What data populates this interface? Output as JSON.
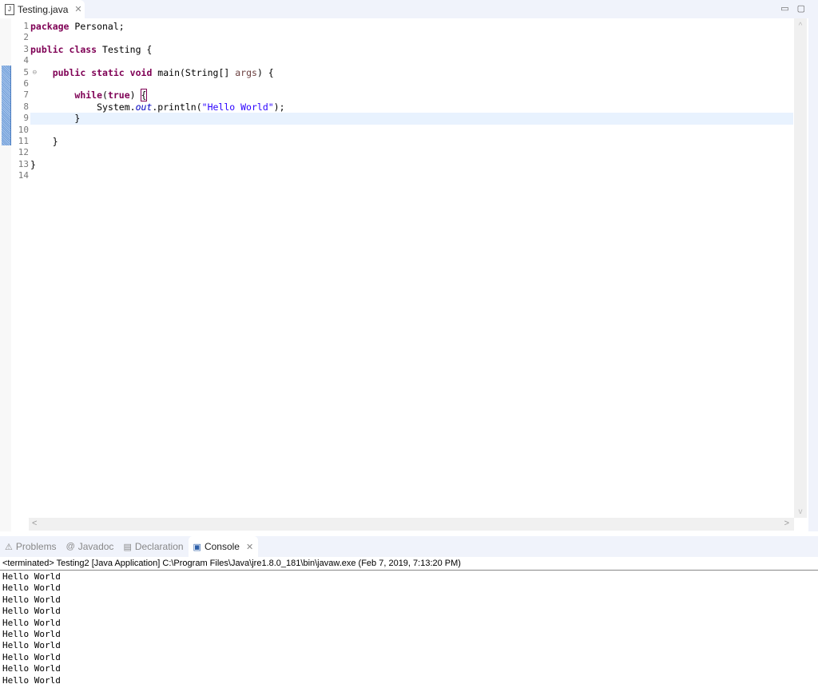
{
  "editor_tab": {
    "icon": "java-file-icon",
    "icon_text": "J",
    "label": "Testing.java",
    "close": "✕"
  },
  "window_buttons": {
    "minimize": "▭",
    "maximize": "▢"
  },
  "gutter": {
    "lines": [
      "1",
      "2",
      "3",
      "4",
      "5",
      "6",
      "7",
      "8",
      "9",
      "10",
      "11",
      "12",
      "13",
      "14"
    ]
  },
  "code": {
    "l1": {
      "kw": "package",
      "rest": " Personal;"
    },
    "l3": {
      "kw1": "public",
      "kw2": "class",
      "rest": " Testing {"
    },
    "l5": {
      "kw1": "public",
      "kw2": "static",
      "kw3": "void",
      "mid": " main(String[] ",
      "arg": "args",
      "end": ") {"
    },
    "l7": {
      "kw": "while",
      "p1": "(",
      "kw2": "true",
      "p2": ") ",
      "brace": "{"
    },
    "l8": {
      "pre": "System.",
      "field": "out",
      "mid": ".println(",
      "str": "\"Hello World\"",
      "end": ");"
    },
    "l9": "}",
    "l11": "}",
    "l13": "}"
  },
  "scroll": {
    "up": "^",
    "down": "v",
    "left": "<",
    "right": ">"
  },
  "bottom_tabs": [
    {
      "label": "Problems",
      "icon": "⚠"
    },
    {
      "label": "Javadoc",
      "icon": "@"
    },
    {
      "label": "Declaration",
      "icon": "▤"
    },
    {
      "label": "Console",
      "icon": "▣",
      "close": "✕"
    }
  ],
  "console": {
    "status": "<terminated> Testing2 [Java Application] C:\\Program Files\\Java\\jre1.8.0_181\\bin\\javaw.exe (Feb 7, 2019, 7:13:20 PM)",
    "output": [
      "Hello World",
      "Hello World",
      "Hello World",
      "Hello World",
      "Hello World",
      "Hello World",
      "Hello World",
      "Hello World",
      "Hello World",
      "Hello World"
    ]
  }
}
